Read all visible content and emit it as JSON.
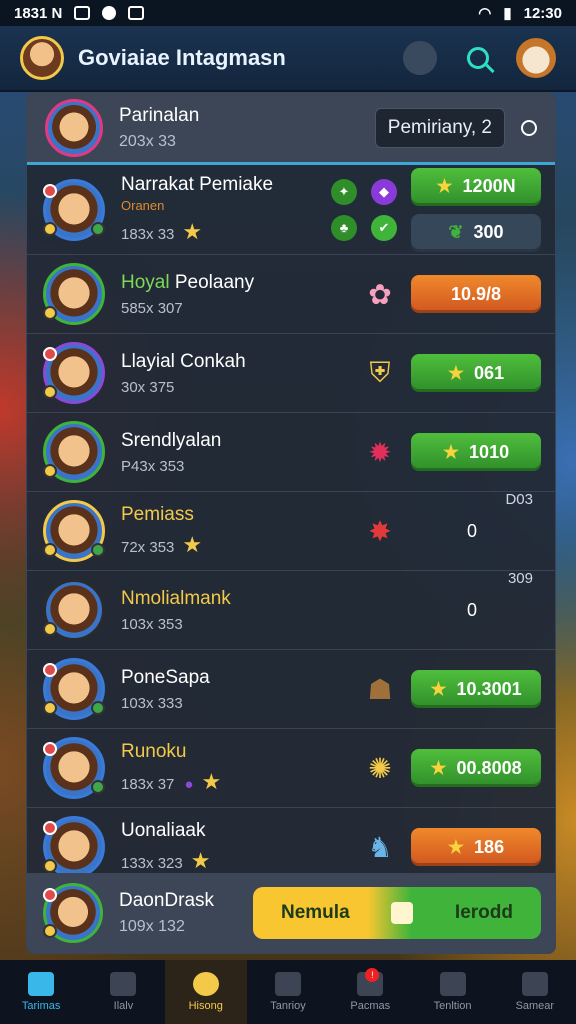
{
  "status_bar": {
    "time_left": "1831 N",
    "time_right": "12:30"
  },
  "header": {
    "title": "Goviaiae Intagmasn"
  },
  "panel_head": {
    "name": "Parinalan",
    "stats": "203x 33",
    "rank_label": "Pemiriany,",
    "rank_value": "2"
  },
  "rows": [
    {
      "name": "Narrakat Pemiake",
      "subtitle": "Oranen",
      "stats": "183x 33",
      "score_top": "1200N",
      "score_bottom": "300"
    },
    {
      "name_green": "Hoyal",
      "name_rest": "Peolaany",
      "stats": "585x 307",
      "score": "10.9/8"
    },
    {
      "name": "Llayial Conkah",
      "stats": "30x 375",
      "score": "061"
    },
    {
      "name": "Srendlyalan",
      "stats": "P43x 353",
      "score": "1010"
    },
    {
      "name": "Pemiass",
      "stats": "72x 353",
      "small": "D03",
      "plain": "0"
    },
    {
      "name": "Nmolialmank",
      "stats": "103x 353",
      "small": "309",
      "plain": "0"
    },
    {
      "name": "PoneSapa",
      "stats": "103x 333",
      "score": "10.3001"
    },
    {
      "name": "Runoku",
      "stats": "183x 37",
      "score": "00.8008"
    },
    {
      "name": "Uonaliaak",
      "stats": "133x 323",
      "score": "186"
    }
  ],
  "panel_foot": {
    "name": "DaonDrask",
    "stats": "109x 132",
    "btn_left": "Nemula",
    "btn_right": "Ierodd"
  },
  "nav": [
    {
      "label": "Tarimas"
    },
    {
      "label": "Ilalv"
    },
    {
      "label": "Hisong"
    },
    {
      "label": "Tanrioy"
    },
    {
      "label": "Pacmas"
    },
    {
      "label": "Tenltion"
    },
    {
      "label": "Samear"
    }
  ],
  "colors": {
    "accent": "#39b7e8",
    "gold": "#f3c94a",
    "green": "#3fb33a",
    "orange": "#f0892b"
  }
}
